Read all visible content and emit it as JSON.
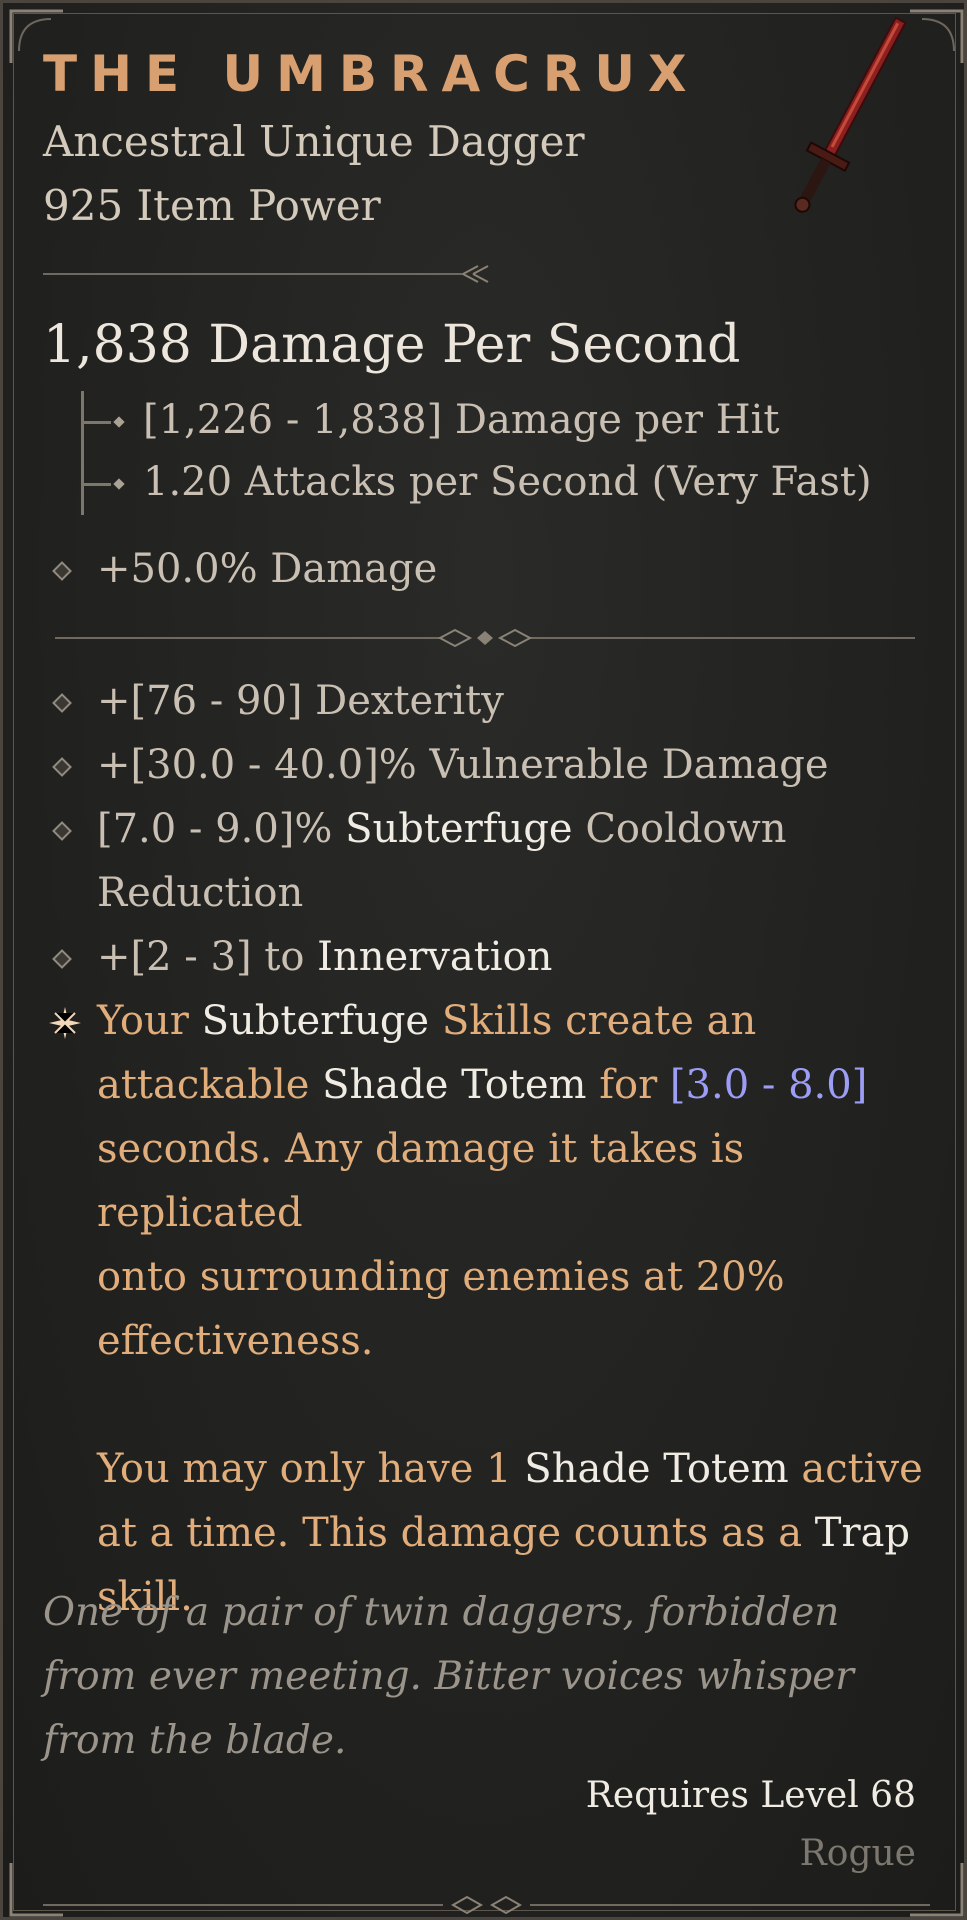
{
  "item": {
    "name": "THE UMBRACRUX",
    "type": "Ancestral Unique Dagger",
    "item_power": "925 Item Power",
    "dps": "1,838 Damage Per Second",
    "damage_per_hit": "[1,226 - 1,838] Damage per Hit",
    "attack_speed": "1.20 Attacks per Second (Very Fast)",
    "implicit": "+50.0% Damage"
  },
  "affixes": {
    "a1": "+[76 - 90] Dexterity",
    "a2": "+[30.0 - 40.0]% Vulnerable Damage",
    "a3_pre": "[7.0 - 9.0]%",
    "a3_skill": "Subterfuge",
    "a3_post1": "Cooldown",
    "a3_post2": "Reduction",
    "a4_pre": "+[2 - 3] to",
    "a4_skill": "Innervation"
  },
  "unique": {
    "l1_a": "Your",
    "l1_b": "Subterfuge",
    "l1_c": "Skills create an",
    "l2_a": "attackable",
    "l2_b": "Shade Totem",
    "l2_c": "for",
    "l2_d": "[3.0 - 8.0]",
    "l3": "seconds. Any damage it takes is replicated",
    "l4": "onto surrounding enemies at 20%",
    "l5": "effectiveness.",
    "l6_a": "You may only have 1",
    "l6_b": "Shade Totem",
    "l6_c": "active",
    "l7_a": "at a time. This damage counts as a",
    "l7_b": "Trap",
    "l8": "skill."
  },
  "flavor": "One of a pair of twin daggers, forbidden from ever meeting. Bitter voices whisper from the blade.",
  "requirements": {
    "level": "Requires Level 68",
    "class": "Rogue"
  },
  "colors": {
    "title": "#d8a070",
    "unique_effect": "#e0ad7b",
    "value_range": "#9c9df5",
    "flavor": "#9a948b"
  }
}
